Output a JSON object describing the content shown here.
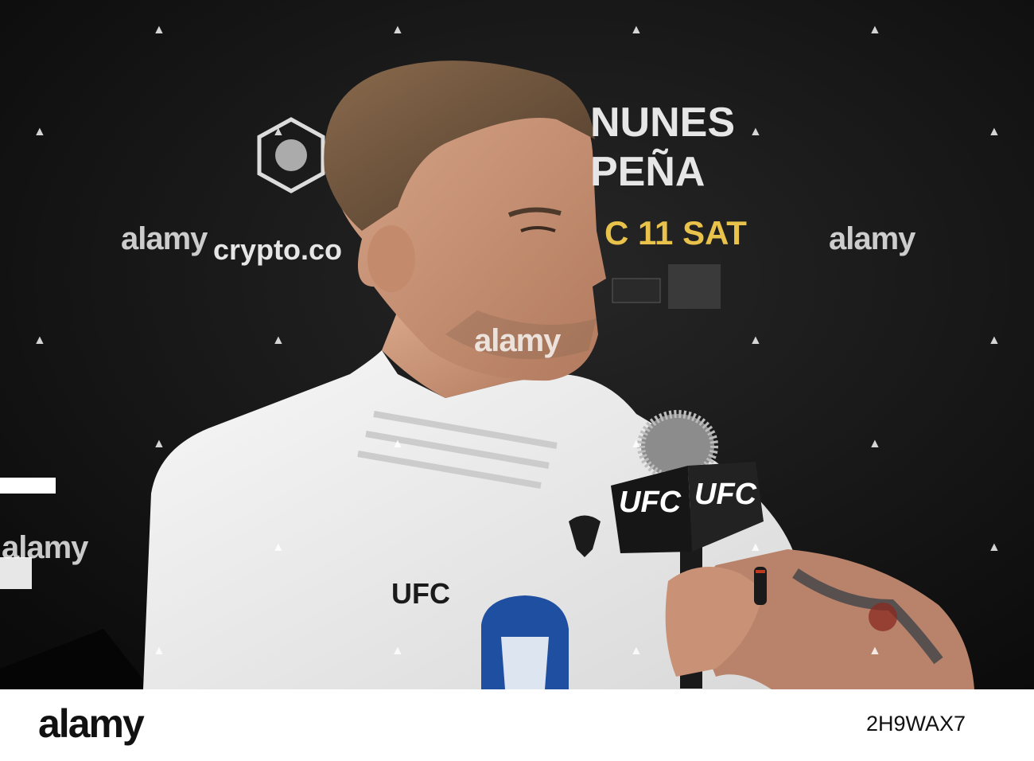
{
  "photo": {
    "backdrop_text": {
      "sponsor": "crypto.co",
      "event_line_1": "NUNES",
      "event_line_2": "PEÑA",
      "event_date": "C 11 SAT"
    },
    "mic_flag_left": "UFC",
    "mic_flag_right": "UFC",
    "shirt_logo": "UFC",
    "colors": {
      "backdrop": "#141414",
      "shirt": "#f2f2f2",
      "shirt_patch": "#1f4fa0",
      "watermark": "#ffffff"
    }
  },
  "watermark": {
    "word": "alamy",
    "mark_icon": "alamy-a-icon"
  },
  "footer": {
    "logo": "alamy",
    "image_id": "2H9WAX7"
  }
}
